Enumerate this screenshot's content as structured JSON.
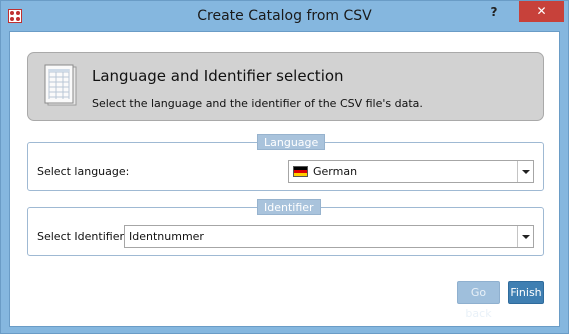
{
  "window": {
    "title": "Create Catalog from CSV",
    "help_label": "?",
    "close_label": "✕",
    "app_icon": "catalog-app-icon"
  },
  "header": {
    "icon": "csv-document-icon",
    "title": "Language and Identifier selection",
    "subtitle": "Select the language and the identifier of the CSV file's data."
  },
  "language_group": {
    "legend": "Language",
    "label": "Select language:",
    "selected_value": "German",
    "flag_icon": "german-flag-icon"
  },
  "identifier_group": {
    "legend": "Identifier",
    "label": "Select Identifier:",
    "selected_value": "Identnummer"
  },
  "buttons": {
    "back_label": "Go back",
    "finish_label": "Finish"
  },
  "colors": {
    "title_bar": "#85b7df",
    "close_button": "#c7413a",
    "finish_button": "#3f7fb2",
    "legend_bg": "#a9c3dc"
  }
}
